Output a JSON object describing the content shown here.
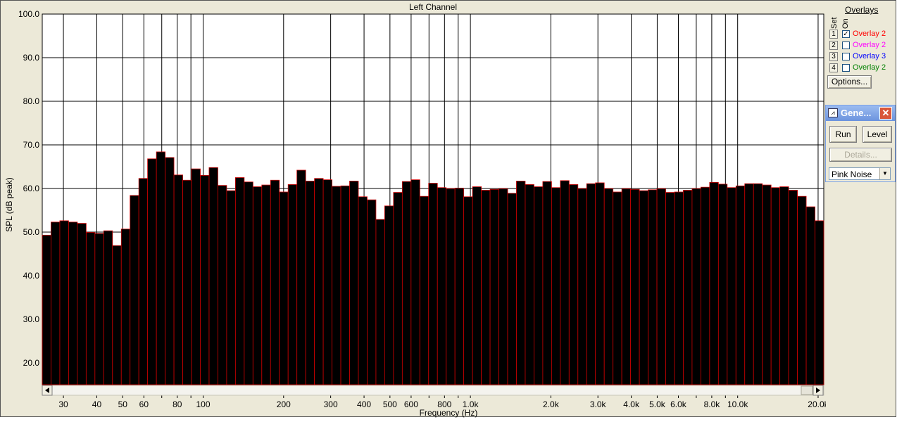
{
  "overlays": {
    "title": "Overlays",
    "col_set": "Set",
    "col_on": "On",
    "items": [
      {
        "num": "1",
        "label": "Overlay 2",
        "checked": true,
        "color": "#ff0000"
      },
      {
        "num": "2",
        "label": "Overlay 2",
        "checked": false,
        "color": "#ff00ff"
      },
      {
        "num": "3",
        "label": "Overlay 3",
        "checked": false,
        "color": "#0000ff"
      },
      {
        "num": "4",
        "label": "Overlay 2",
        "checked": false,
        "color": "#008000"
      }
    ],
    "options_label": "Options..."
  },
  "generator": {
    "title": "Gene...",
    "run_label": "Run",
    "level_label": "Level",
    "details_label": "Details...",
    "signal_value": "Pink Noise"
  },
  "colors": {
    "bar_fill": "#000000",
    "bar_edge": "#cc0000",
    "plot_bg": "#ffffff",
    "grid": "#000000",
    "frame_bg": "#ece9d8",
    "titlebar": "#7aa1e6"
  },
  "chart_data": {
    "type": "bar",
    "title": "Left Channel",
    "xlabel": "Frequency (Hz)",
    "ylabel": "SPL (dB peak)",
    "x_scale": "log",
    "xlim": [
      25,
      21000
    ],
    "ylim": [
      15,
      100
    ],
    "grid": true,
    "y_ticks": [
      "20.0",
      "30.0",
      "40.0",
      "50.0",
      "60.0",
      "70.0",
      "80.0",
      "90.0",
      "100.0"
    ],
    "x_ticks": [
      {
        "v": 30,
        "label": "30"
      },
      {
        "v": 40,
        "label": "40"
      },
      {
        "v": 50,
        "label": "50"
      },
      {
        "v": 60,
        "label": "60"
      },
      {
        "v": 70,
        "label": ""
      },
      {
        "v": 80,
        "label": "80"
      },
      {
        "v": 90,
        "label": ""
      },
      {
        "v": 100,
        "label": "100"
      },
      {
        "v": 200,
        "label": "200"
      },
      {
        "v": 300,
        "label": "300"
      },
      {
        "v": 400,
        "label": "400"
      },
      {
        "v": 500,
        "label": "500"
      },
      {
        "v": 600,
        "label": "600"
      },
      {
        "v": 700,
        "label": ""
      },
      {
        "v": 800,
        "label": "800"
      },
      {
        "v": 900,
        "label": ""
      },
      {
        "v": 1000,
        "label": "1.0k"
      },
      {
        "v": 2000,
        "label": "2.0k"
      },
      {
        "v": 3000,
        "label": "3.0k"
      },
      {
        "v": 4000,
        "label": "4.0k"
      },
      {
        "v": 5000,
        "label": "5.0k"
      },
      {
        "v": 6000,
        "label": "6.0k"
      },
      {
        "v": 7000,
        "label": ""
      },
      {
        "v": 8000,
        "label": "8.0k"
      },
      {
        "v": 9000,
        "label": ""
      },
      {
        "v": 10000,
        "label": "10.0k"
      },
      {
        "v": 20000,
        "label": "20.0k"
      }
    ],
    "bands_per_octave": 12,
    "values": [
      49.3,
      52.3,
      52.6,
      52.3,
      52.0,
      49.9,
      49.7,
      50.3,
      46.9,
      50.7,
      58.4,
      62.3,
      66.8,
      68.4,
      67.1,
      63.1,
      61.9,
      64.5,
      63.0,
      64.8,
      60.7,
      59.5,
      62.5,
      61.5,
      60.4,
      60.8,
      61.9,
      59.2,
      60.9,
      64.2,
      61.7,
      62.3,
      62.0,
      60.5,
      60.6,
      61.7,
      58.1,
      57.4,
      52.9,
      56.0,
      59.1,
      61.6,
      62.0,
      58.2,
      61.2,
      60.2,
      59.9,
      60.1,
      58.1,
      60.4,
      59.6,
      59.8,
      59.9,
      58.9,
      61.7,
      60.9,
      60.4,
      61.6,
      60.2,
      61.8,
      60.9,
      59.9,
      61.1,
      61.3,
      60.0,
      59.2,
      59.9,
      59.8,
      59.5,
      59.7,
      59.9,
      59.1,
      59.2,
      59.6,
      60.0,
      60.3,
      61.4,
      61.0,
      60.2,
      60.6,
      61.1,
      61.1,
      60.8,
      60.2,
      60.4,
      59.6,
      58.2,
      55.8,
      52.6
    ]
  }
}
